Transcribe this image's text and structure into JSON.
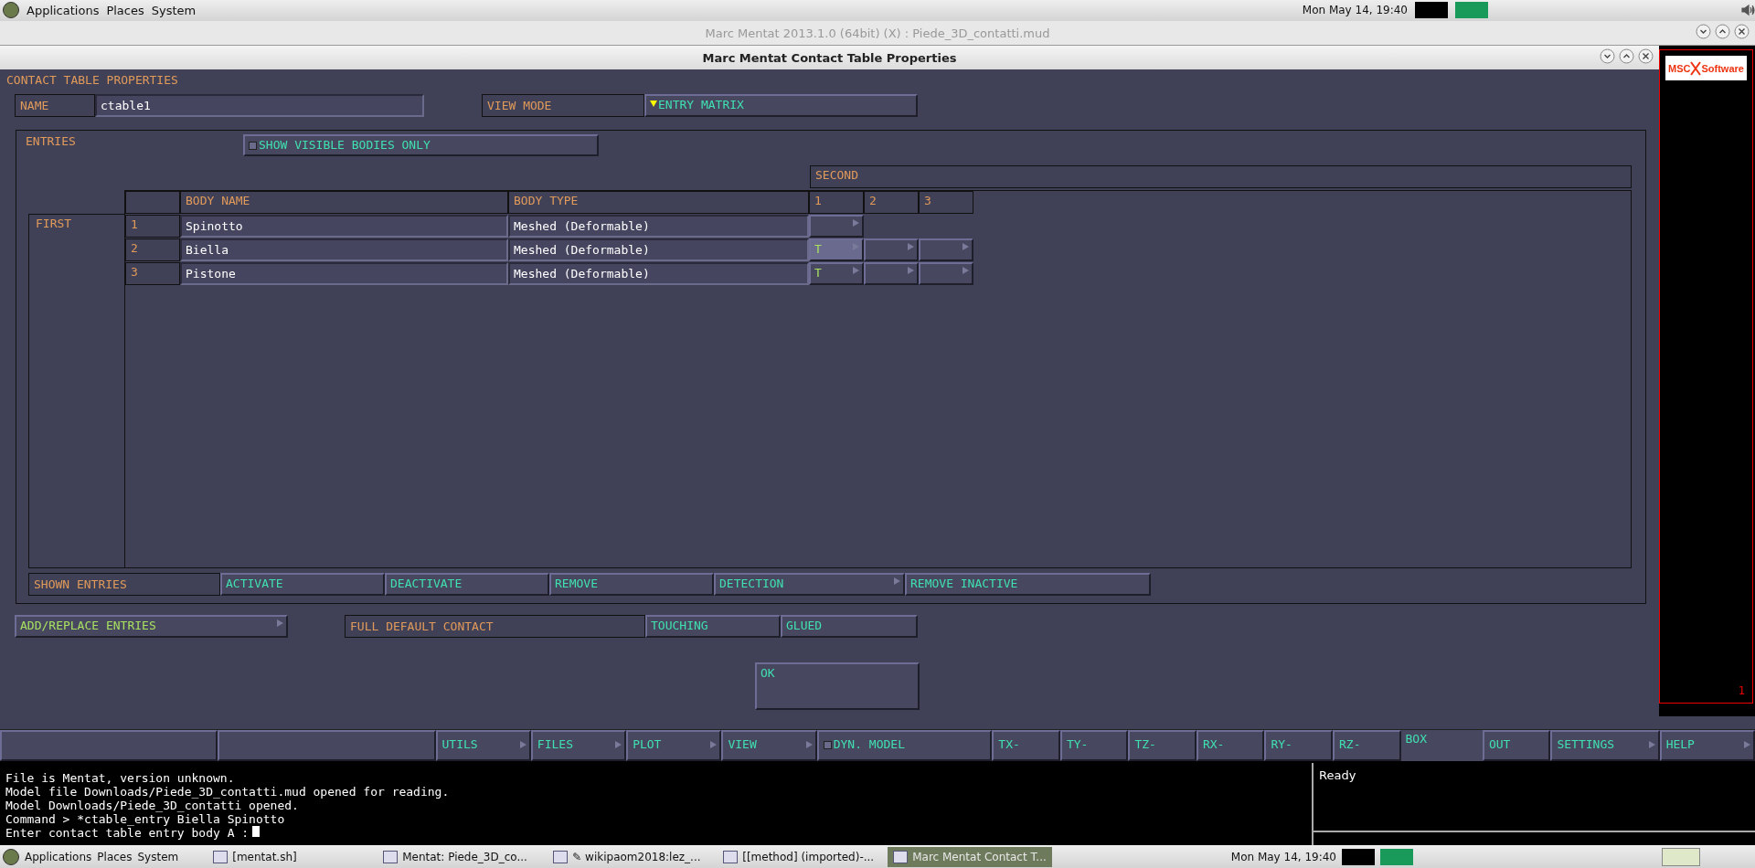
{
  "desktop_panel": {
    "menus": [
      "Applications",
      "Places",
      "System"
    ],
    "clock": "Mon May 14, 19:40"
  },
  "main_window": {
    "title": "Marc Mentat 2013.1.0 (64bit) (X) : Piede_3D_contatti.mud"
  },
  "dialog": {
    "title": "Marc Mentat Contact Table Properties",
    "heading": "CONTACT TABLE PROPERTIES",
    "name_label": "NAME",
    "name_value": "ctable1",
    "view_mode_label": "VIEW MODE",
    "view_mode_value": "ENTRY MATRIX",
    "entries": {
      "label": "ENTRIES",
      "show_visible": {
        "label": "SHOW VISIBLE BODIES ONLY",
        "checked": false
      },
      "second_label": "SECOND",
      "first_label": "FIRST",
      "columns": [
        "BODY NAME",
        "BODY TYPE"
      ],
      "second_columns": [
        "1",
        "2",
        "3"
      ],
      "rows": [
        {
          "index": "1",
          "name": "Spinotto",
          "type": "Meshed (Deformable)",
          "cells": [
            {
              "highlighted": false
            }
          ]
        },
        {
          "index": "2",
          "name": "Biella",
          "type": "Meshed (Deformable)",
          "cells": [
            {
              "value": "T",
              "highlighted": true
            },
            {
              "highlighted": false
            },
            {
              "highlighted": false
            }
          ]
        },
        {
          "index": "3",
          "name": "Pistone",
          "type": "Meshed (Deformable)",
          "cells": [
            {
              "value": "T",
              "highlighted": false
            },
            {
              "highlighted": false
            },
            {
              "highlighted": false
            }
          ]
        }
      ]
    },
    "shown_entries_label": "SHOWN ENTRIES",
    "shown_entries_buttons": [
      {
        "label": "ACTIVATE",
        "menu": false
      },
      {
        "label": "DEACTIVATE",
        "menu": false
      },
      {
        "label": "REMOVE",
        "menu": false
      },
      {
        "label": "DETECTION",
        "menu": true
      },
      {
        "label": "REMOVE INACTIVE",
        "menu": false
      }
    ],
    "add_replace": {
      "label": "ADD/REPLACE ENTRIES",
      "menu": true
    },
    "full_default_label": "FULL DEFAULT CONTACT",
    "full_default_buttons": [
      "TOUCHING",
      "GLUED"
    ],
    "ok": "OK"
  },
  "viewport": {
    "logo": [
      "MSC",
      "Software"
    ],
    "marker": "1"
  },
  "toolbar": [
    {
      "kind": "blank"
    },
    {
      "kind": "blank"
    },
    {
      "kind": "menu",
      "label": "UTILS"
    },
    {
      "kind": "menu",
      "label": "FILES"
    },
    {
      "kind": "menu",
      "label": "PLOT"
    },
    {
      "kind": "menu",
      "label": "VIEW"
    },
    {
      "kind": "toggle",
      "label": "DYN. MODEL",
      "checked": false
    },
    {
      "kind": "button",
      "label": "TX-"
    },
    {
      "kind": "button",
      "label": "TY-"
    },
    {
      "kind": "button",
      "label": "TZ-"
    },
    {
      "kind": "button",
      "label": "RX-"
    },
    {
      "kind": "button",
      "label": "RY-"
    },
    {
      "kind": "button",
      "label": "RZ-"
    },
    {
      "kind": "flat",
      "label": "BOX"
    },
    {
      "kind": "button",
      "label": "OUT"
    },
    {
      "kind": "menu",
      "label": "SETTINGS"
    },
    {
      "kind": "menu",
      "label": "HELP"
    }
  ],
  "console": {
    "lines": [
      "File is Mentat, version unknown.",
      "Model file Downloads/Piede_3D_contatti.mud opened for reading.",
      "Model Downloads/Piede_3D_contatti opened.",
      "Command > *ctable_entry Biella Spinotto",
      "Enter contact table entry body A :"
    ],
    "status": "Ready"
  },
  "taskbar": {
    "menus": [
      "Applications",
      "Places",
      "System"
    ],
    "items": [
      {
        "label": "[mentat.sh]",
        "selected": false
      },
      {
        "label": "Mentat: Piede_3D_co...",
        "selected": false
      },
      {
        "label": "✎ wikipaom2018:lez_...",
        "selected": false
      },
      {
        "label": "[[method] (imported)-...",
        "selected": false
      },
      {
        "label": "Marc Mentat Contact T...",
        "selected": true
      }
    ],
    "clock": "Mon May 14, 19:40"
  }
}
